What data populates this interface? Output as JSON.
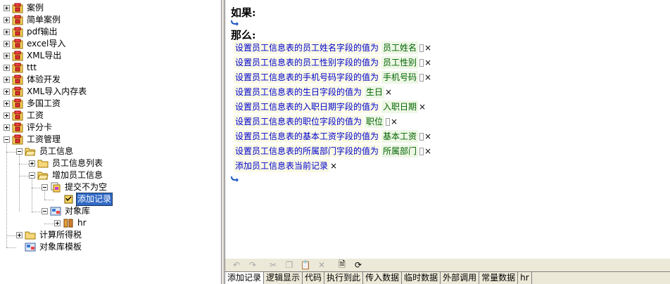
{
  "tree": {
    "items": [
      {
        "label": "案例",
        "indent": 0,
        "icon": "rule-package-icon",
        "expander": "plus"
      },
      {
        "label": "简单案例",
        "indent": 0,
        "icon": "rule-package-icon",
        "expander": "plus"
      },
      {
        "label": "pdf输出",
        "indent": 0,
        "icon": "rule-package-icon",
        "expander": "plus"
      },
      {
        "label": "excel导入",
        "indent": 0,
        "icon": "rule-package-icon",
        "expander": "plus"
      },
      {
        "label": "XML导出",
        "indent": 0,
        "icon": "rule-package-icon",
        "expander": "plus"
      },
      {
        "label": "ttt",
        "indent": 0,
        "icon": "rule-package-icon",
        "expander": "plus"
      },
      {
        "label": "体验开发",
        "indent": 0,
        "icon": "rule-package-icon",
        "expander": "plus"
      },
      {
        "label": "XML导入内存表",
        "indent": 0,
        "icon": "rule-package-icon",
        "expander": "plus"
      },
      {
        "label": "多国工资",
        "indent": 0,
        "icon": "rule-package-icon",
        "expander": "plus"
      },
      {
        "label": "工资",
        "indent": 0,
        "icon": "rule-package-icon",
        "expander": "plus"
      },
      {
        "label": "评分卡",
        "indent": 0,
        "icon": "rule-package-icon",
        "expander": "plus"
      },
      {
        "label": "工资管理",
        "indent": 0,
        "icon": "rule-package-icon",
        "expander": "minus"
      },
      {
        "label": "员工信息",
        "indent": 1,
        "icon": "open-folder-icon",
        "expander": "minus"
      },
      {
        "label": "员工信息列表",
        "indent": 2,
        "icon": "folder-icon",
        "expander": "plus"
      },
      {
        "label": "增加员工信息",
        "indent": 2,
        "icon": "open-folder-icon",
        "expander": "minus"
      },
      {
        "label": "提交不为空",
        "indent": 3,
        "icon": "rule-set-icon",
        "expander": "minus"
      },
      {
        "label": "添加记录",
        "indent": 4,
        "icon": "rule-icon",
        "expander": "none",
        "selected": true
      },
      {
        "label": "对象库",
        "indent": 3,
        "icon": "object-library-icon",
        "expander": "minus"
      },
      {
        "label": "hr",
        "indent": 4,
        "icon": "database-icon",
        "expander": "plus"
      },
      {
        "label": "计算所得税",
        "indent": 1,
        "icon": "folder-icon",
        "expander": "plus"
      },
      {
        "label": "对象库模板",
        "indent": 1,
        "icon": "object-library-icon",
        "expander": "none"
      }
    ]
  },
  "editor": {
    "if_label": "如果:",
    "then_label": "那么:",
    "actions": [
      {
        "text": "设置员工信息表的员工姓名字段的值为",
        "value": "员工姓名",
        "box": true
      },
      {
        "text": "设置员工信息表的员工性别字段的值为",
        "value": "员工性别",
        "box": true
      },
      {
        "text": "设置员工信息表的手机号码字段的值为",
        "value": "手机号码",
        "box": true
      },
      {
        "text": "设置员工信息表的生日字段的值为",
        "value": "生日",
        "box": false
      },
      {
        "text": "设置员工信息表的入职日期字段的值为",
        "value": "入职日期",
        "box": false
      },
      {
        "text": "设置员工信息表的职位字段的值为",
        "value": "职位",
        "box": true
      },
      {
        "text": "设置员工信息表的基本工资字段的值为",
        "value": "基本工资",
        "box": true
      },
      {
        "text": "设置员工信息表的所属部门字段的值为",
        "value": "所属部门",
        "box": true
      },
      {
        "text": "添加员工信息表当前记录",
        "value": "",
        "box": false
      }
    ],
    "delete_glyph": "×"
  },
  "toolbar": {
    "buttons": [
      {
        "name": "undo-icon",
        "glyph": "↶",
        "enabled": false
      },
      {
        "name": "redo-icon",
        "glyph": "↷",
        "enabled": false
      },
      {
        "name": "cut-icon",
        "glyph": "✂",
        "enabled": false
      },
      {
        "name": "copy-icon",
        "glyph": "❐",
        "enabled": false
      },
      {
        "name": "paste-icon",
        "glyph": "📋",
        "enabled": false
      },
      {
        "name": "delete-icon",
        "glyph": "✕",
        "enabled": false
      },
      {
        "name": "export-icon",
        "glyph": "🗎",
        "enabled": true
      },
      {
        "name": "refresh-icon",
        "glyph": "⟳",
        "enabled": true
      }
    ]
  },
  "tabs": [
    {
      "label": "添加记录",
      "active": true
    },
    {
      "label": "逻辑显示"
    },
    {
      "label": "代码"
    },
    {
      "label": "执行到此"
    },
    {
      "label": "传入数据"
    },
    {
      "label": "临时数据"
    },
    {
      "label": "外部调用"
    },
    {
      "label": "常量数据"
    },
    {
      "label": "hr"
    }
  ],
  "colors": {
    "action_text": "#0000cc",
    "value_text": "#006400",
    "selection": "#316ac5"
  }
}
